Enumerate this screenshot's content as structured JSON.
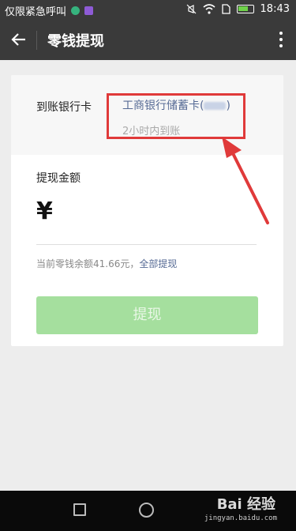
{
  "status": {
    "carrier": "仅限紧急呼叫",
    "time": "18:43",
    "icons": [
      "app-green-icon",
      "app-purple-icon",
      "mute-icon",
      "wifi-icon",
      "sim-icon",
      "battery-icon"
    ],
    "colors": {
      "green": "#36b37e",
      "purple": "#8e5bd6"
    }
  },
  "appbar": {
    "title": "零钱提现"
  },
  "bank": {
    "label": "到账银行卡",
    "name_prefix": "工商银行储蓄卡(",
    "name_suffix": ")",
    "arrival": "2小时内到账"
  },
  "amount": {
    "label": "提现金额",
    "currency_symbol": "¥",
    "balance_prefix": "当前零钱余额41.66元，",
    "all_link": "全部提现"
  },
  "button": {
    "label": "提现"
  },
  "watermark": {
    "brand": "Bai 经验",
    "url": "jingyan.baidu.com"
  },
  "colors": {
    "accent_blue": "#576b95",
    "button_green": "#a5df9e",
    "highlight_red": "#e03a3a"
  }
}
